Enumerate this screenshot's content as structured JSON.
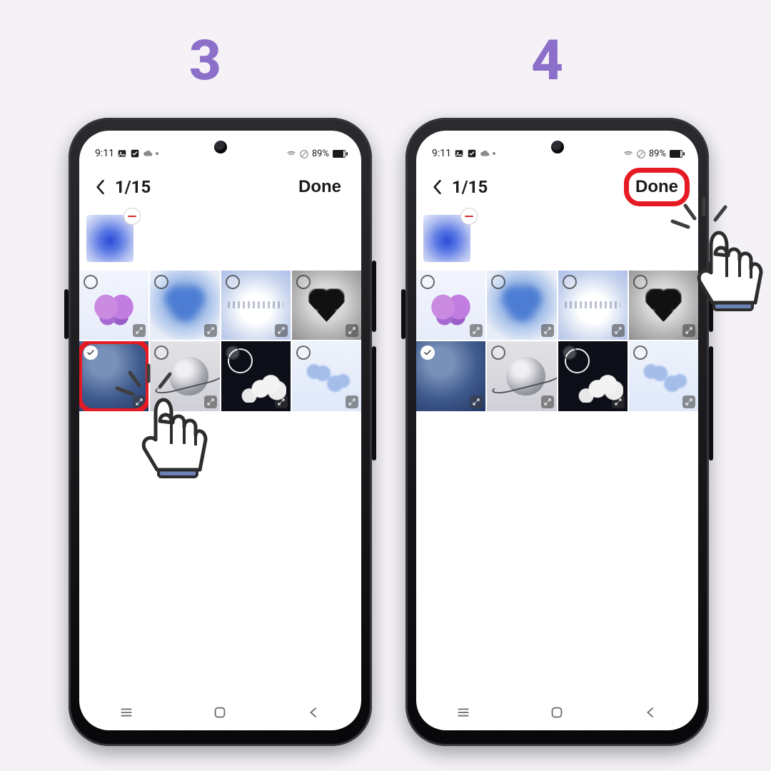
{
  "steps": {
    "left": "3",
    "right": "4"
  },
  "status": {
    "time": "9:11",
    "battery_text": "89%"
  },
  "header": {
    "counter": "1/15",
    "done_label": "Done"
  },
  "tiles": [
    {
      "id": "butterfly",
      "selected": false
    },
    {
      "id": "heartblur",
      "selected": false
    },
    {
      "id": "texthaze",
      "selected": false
    },
    {
      "id": "darkheart",
      "selected": false
    },
    {
      "id": "navyblue",
      "selected": true
    },
    {
      "id": "planet",
      "selected": false
    },
    {
      "id": "nightclouds",
      "selected": false
    },
    {
      "id": "skyclouds",
      "selected": false
    }
  ]
}
